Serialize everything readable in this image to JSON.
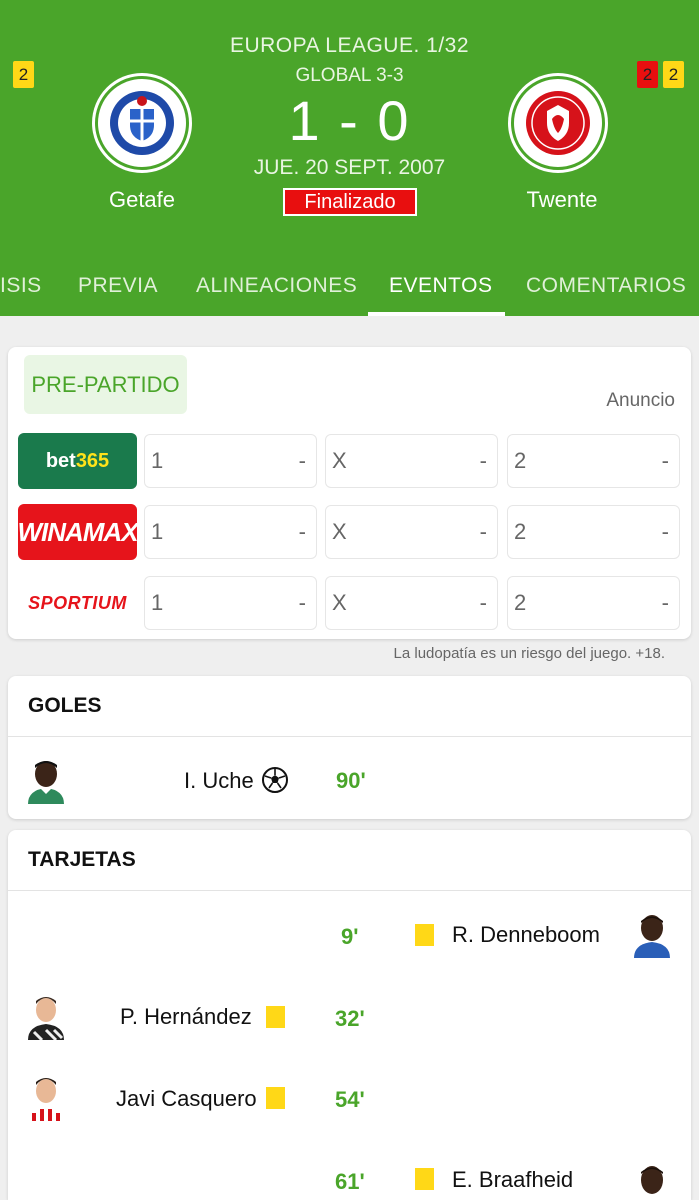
{
  "match": {
    "competition": "EUROPA LEAGUE. 1/32",
    "aggregate": "GLOBAL 3-3",
    "score": "1 - 0",
    "date": "JUE. 20 SEPT. 2007",
    "status": "Finalizado",
    "home": {
      "name": "Getafe",
      "yellow_cards": "2"
    },
    "away": {
      "name": "Twente",
      "red_cards": "2",
      "yellow_cards": "2"
    }
  },
  "tabs": [
    {
      "label": "ISIS"
    },
    {
      "label": "PREVIA"
    },
    {
      "label": "ALINEACIONES"
    },
    {
      "label": "EVENTOS",
      "active": true
    },
    {
      "label": "COMENTARIOS"
    }
  ],
  "odds": {
    "pre_label": "PRE-PARTIDO",
    "ad_label": "Anuncio",
    "bookmakers": [
      {
        "name_a": "bet",
        "name_b": "365",
        "outcomes": [
          {
            "label": "1",
            "value": "-"
          },
          {
            "label": "X",
            "value": "-"
          },
          {
            "label": "2",
            "value": "-"
          }
        ]
      },
      {
        "name": "WINAMAX",
        "outcomes": [
          {
            "label": "1",
            "value": "-"
          },
          {
            "label": "X",
            "value": "-"
          },
          {
            "label": "2",
            "value": "-"
          }
        ]
      },
      {
        "name": "SPORTIUM",
        "outcomes": [
          {
            "label": "1",
            "value": "-"
          },
          {
            "label": "X",
            "value": "-"
          },
          {
            "label": "2",
            "value": "-"
          }
        ]
      }
    ],
    "disclaimer": "La ludopatía es un riesgo del juego. +18."
  },
  "goals": {
    "title": "GOLES",
    "items": [
      {
        "player": "I. Uche",
        "minute": "90'",
        "side": "home",
        "icon": "football-icon"
      }
    ]
  },
  "cards": {
    "title": "TARJETAS",
    "items": [
      {
        "player": "R. Denneboom",
        "minute": "9'",
        "side": "away",
        "type": "yellow"
      },
      {
        "player": "P. Hernández",
        "minute": "32'",
        "side": "home",
        "type": "yellow"
      },
      {
        "player": "Javi Casquero",
        "minute": "54'",
        "side": "home",
        "type": "yellow"
      },
      {
        "player": "E. Braafheid",
        "minute": "61'",
        "side": "away",
        "type": "yellow"
      }
    ]
  },
  "colors": {
    "header_green": "#4aa52a",
    "status_red": "#e80f0f",
    "card_yellow": "#ffd817"
  }
}
